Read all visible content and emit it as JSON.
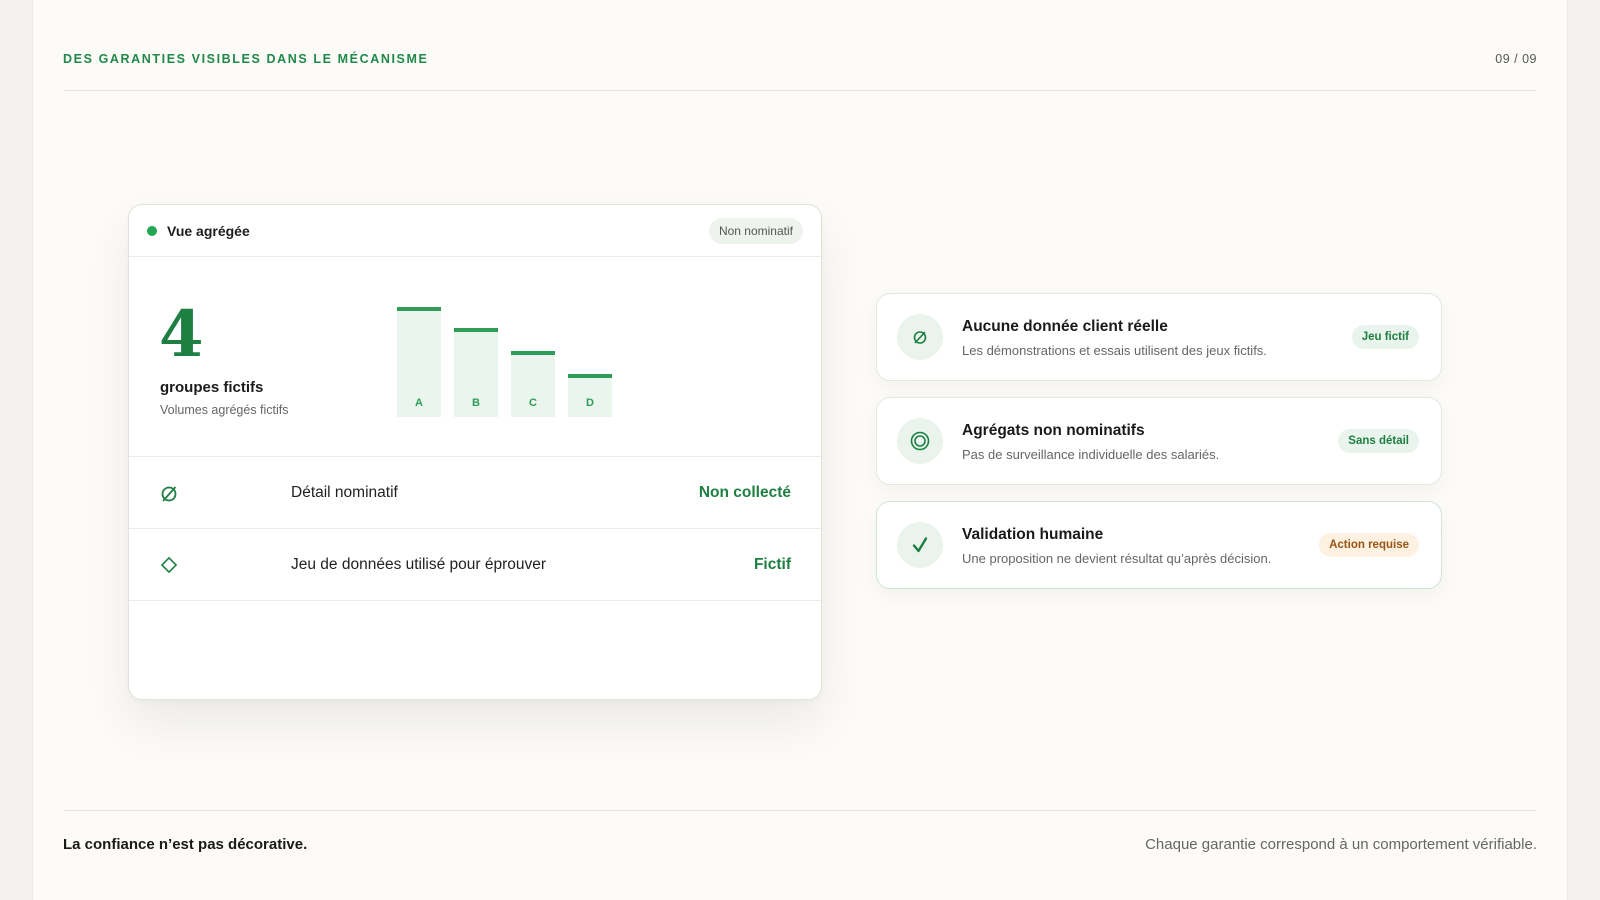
{
  "header": {
    "kicker": "DES GARANTIES VISIBLES DANS LE MÉCANISME",
    "page_number": "09 / 09"
  },
  "panel": {
    "title": "Vue agrégée",
    "badge": "Non nominatif",
    "stat": {
      "value": "4",
      "label": "groupes fictifs",
      "sublabel": "Volumes agrégés fictifs"
    },
    "chart_data": {
      "type": "bar",
      "categories": [
        "A",
        "B",
        "C",
        "D"
      ],
      "values": [
        100,
        81,
        60,
        39
      ]
    },
    "rows": [
      {
        "icon": "empty-set-icon",
        "label": "Détail nominatif",
        "value": "Non collecté"
      },
      {
        "icon": "diamond-icon",
        "label": "Jeu de données utilisé pour éprouver",
        "value": "Fictif"
      }
    ]
  },
  "cards": [
    {
      "icon": "empty-set-icon",
      "title": "Aucune donnée client réelle",
      "description": "Les démonstrations et essais utilisent des jeux fictifs.",
      "tag": "Jeu fictif",
      "tag_tone": "green"
    },
    {
      "icon": "concentric-circle-icon",
      "title": "Agrégats non nominatifs",
      "description": "Pas de surveillance individuelle des salariés.",
      "tag": "Sans détail",
      "tag_tone": "green"
    },
    {
      "icon": "checkmark-icon",
      "title": "Validation humaine",
      "description": "Une proposition ne devient résultat qu’après décision.",
      "tag": "Action requise",
      "tag_tone": "orange"
    }
  ],
  "footer": {
    "left": "La confiance n’est pas décorative.",
    "right": "Chaque garantie correspond à un comportement vérifiable."
  },
  "colors": {
    "accent": "#1e7f42",
    "accent_light": "#eaf6ed",
    "warning": "#9a5312"
  }
}
